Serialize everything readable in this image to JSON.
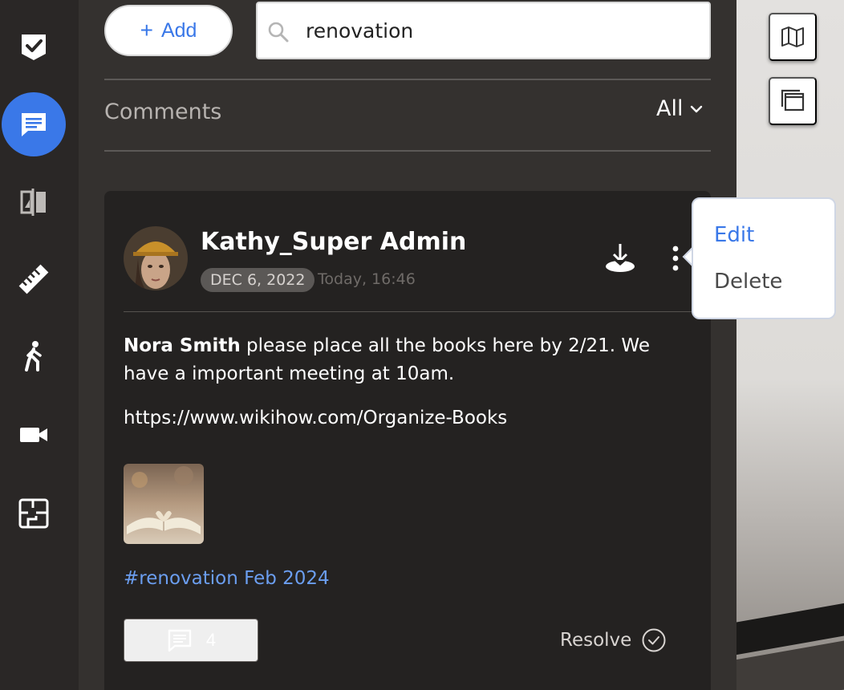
{
  "rail": {
    "items": [
      {
        "name": "tasks",
        "icon": "check-shield-icon",
        "active": false
      },
      {
        "name": "comments",
        "icon": "comment-icon",
        "active": true
      },
      {
        "name": "compare",
        "icon": "split-compare-icon",
        "active": false
      },
      {
        "name": "measure",
        "icon": "ruler-icon",
        "active": false
      },
      {
        "name": "walkthrough",
        "icon": "walking-person-icon",
        "active": false
      },
      {
        "name": "video",
        "icon": "video-camera-icon",
        "active": false
      },
      {
        "name": "floorplan",
        "icon": "floorplan-icon",
        "active": false
      }
    ],
    "active_color": "#3a78e8"
  },
  "toolbar": {
    "add_label": "Add",
    "search_value": "renovation",
    "search_placeholder": "Search"
  },
  "section": {
    "title": "Comments",
    "filter_value": "All"
  },
  "comment": {
    "author": "Kathy_Super Admin",
    "date": "DEC 6, 2022",
    "time": "Today, 16:46",
    "mention": "Nora Smith",
    "text": " please place all the books here by 2/21. We have a important meeting at 10am.",
    "link": "https://www.wikihow.com/Organize-Books",
    "hashtag": "#renovation Feb 2024",
    "reply_count": "4",
    "resolve_label": "Resolve"
  },
  "menu": {
    "edit_label": "Edit",
    "delete_label": "Delete"
  },
  "colors": {
    "accent": "#3a78e8",
    "hashtag": "#6b9ef0",
    "panel_bg": "#34312f",
    "card_bg": "#242221"
  }
}
